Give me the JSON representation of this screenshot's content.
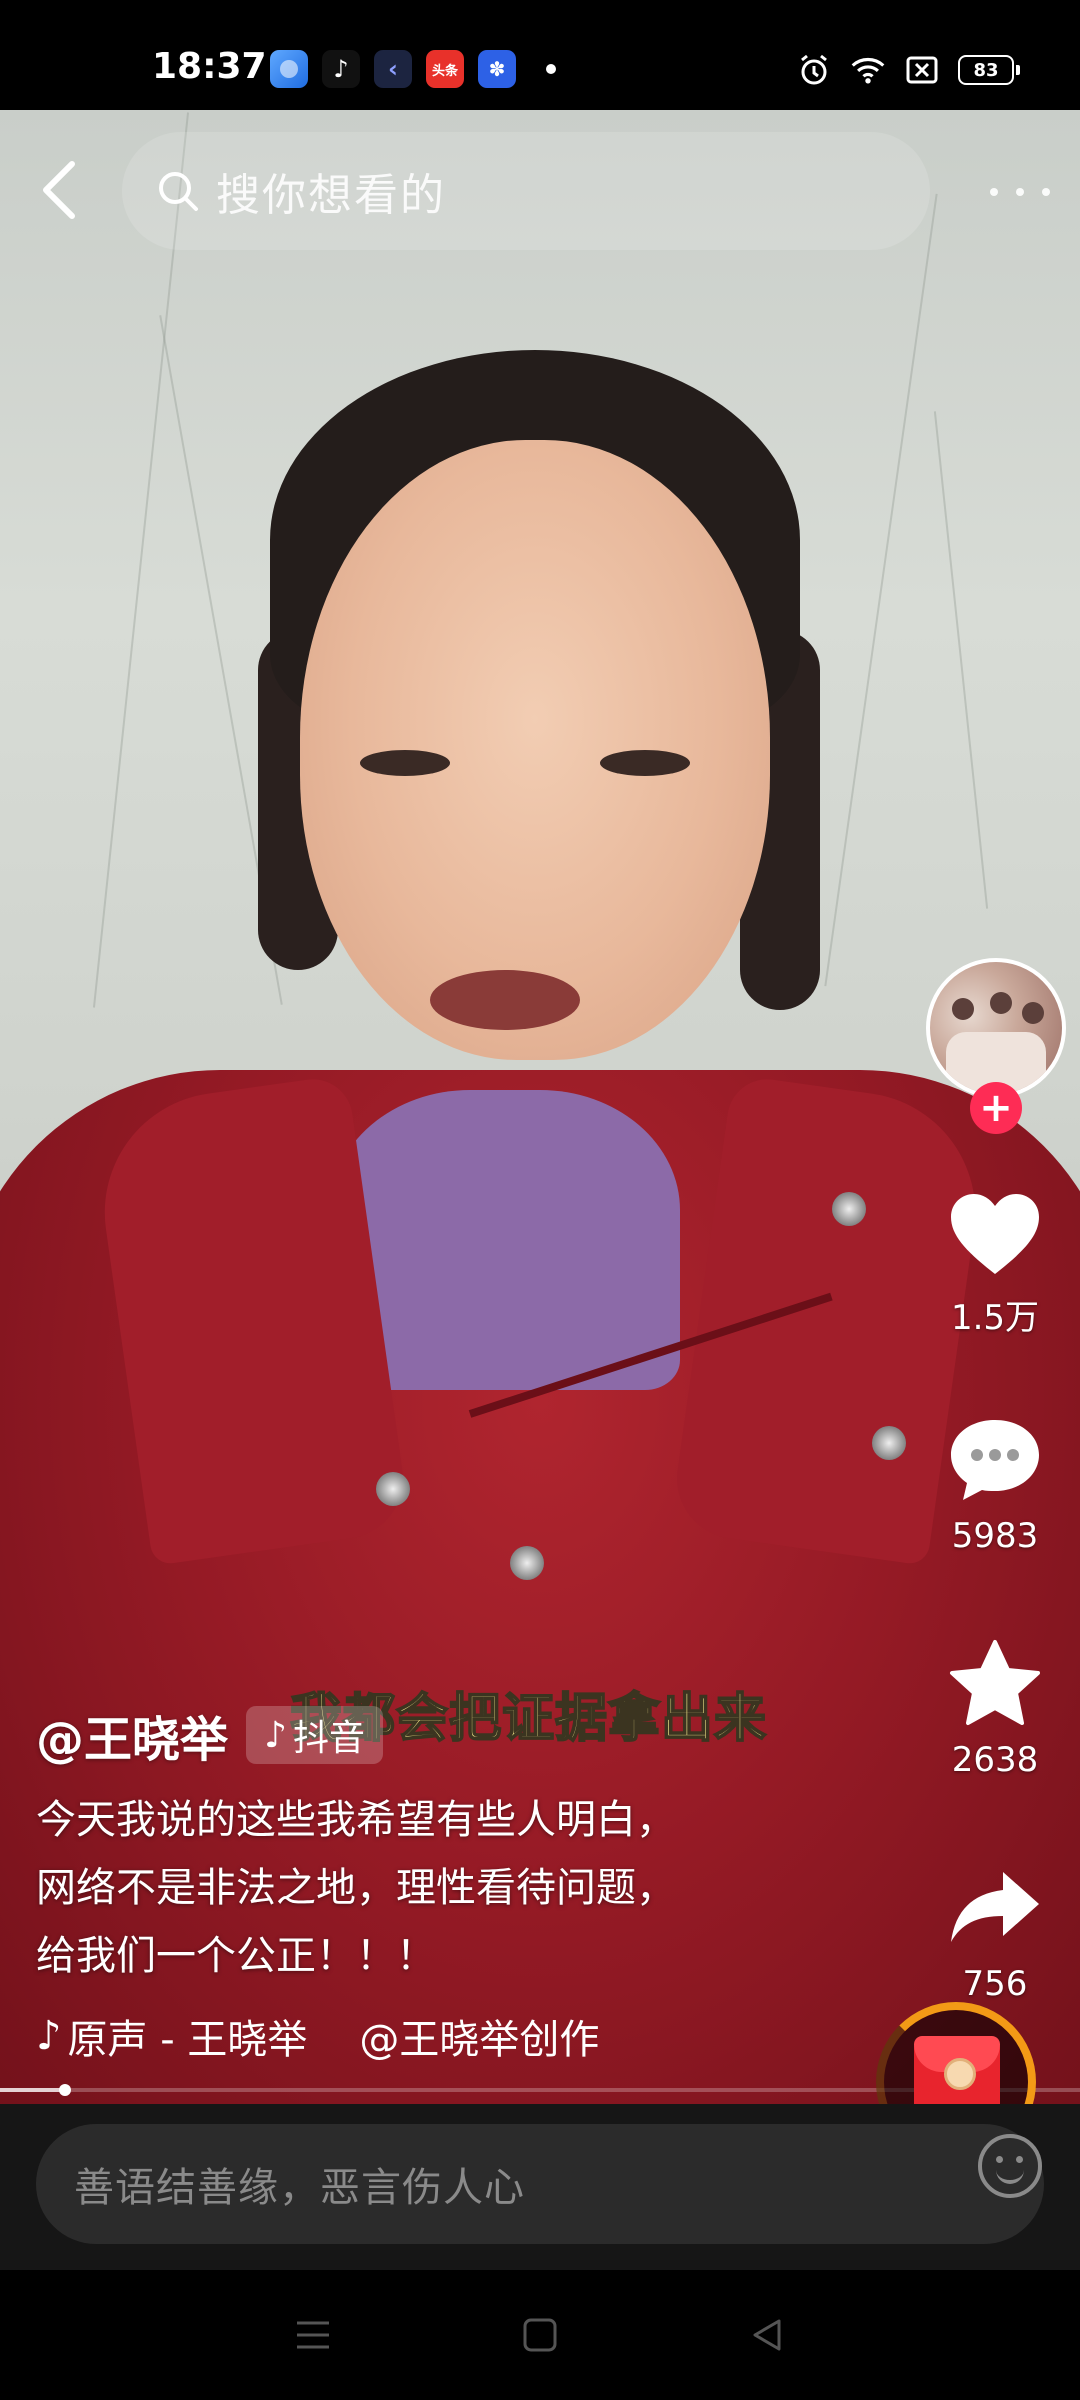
{
  "status_bar": {
    "time": "18:37",
    "apps": [
      "browser-app-icon",
      "tiktok-app-icon",
      "back-app-icon",
      "toutiao-app-icon",
      "baidu-app-icon"
    ],
    "toutiao_label": "头条",
    "battery": "83"
  },
  "top_bar": {
    "search_placeholder": "搜你想看的"
  },
  "video": {
    "subtitle": "我都会把证据拿出来",
    "progress": 0.06
  },
  "rail": {
    "likes": "1.5万",
    "comments": "5983",
    "favorites": "2638",
    "shares": "756"
  },
  "info": {
    "author": "@王晓举",
    "platform_tag": "抖音",
    "caption_lines": [
      "今天我说的这些我希望有些人明白，",
      "网络不是非法之地，理性看待问题，",
      "给我们一个公正！！！"
    ],
    "music_title": "原声 - 王晓举",
    "music_credit": "@王晓举创作"
  },
  "comment_bar": {
    "placeholder": "善语结善缘，恶言伤人心"
  },
  "colors": {
    "accent_red": "#fe2c55",
    "subtitle_yellow": "#f6e98c",
    "red_packet_ring": "#f39a16"
  }
}
